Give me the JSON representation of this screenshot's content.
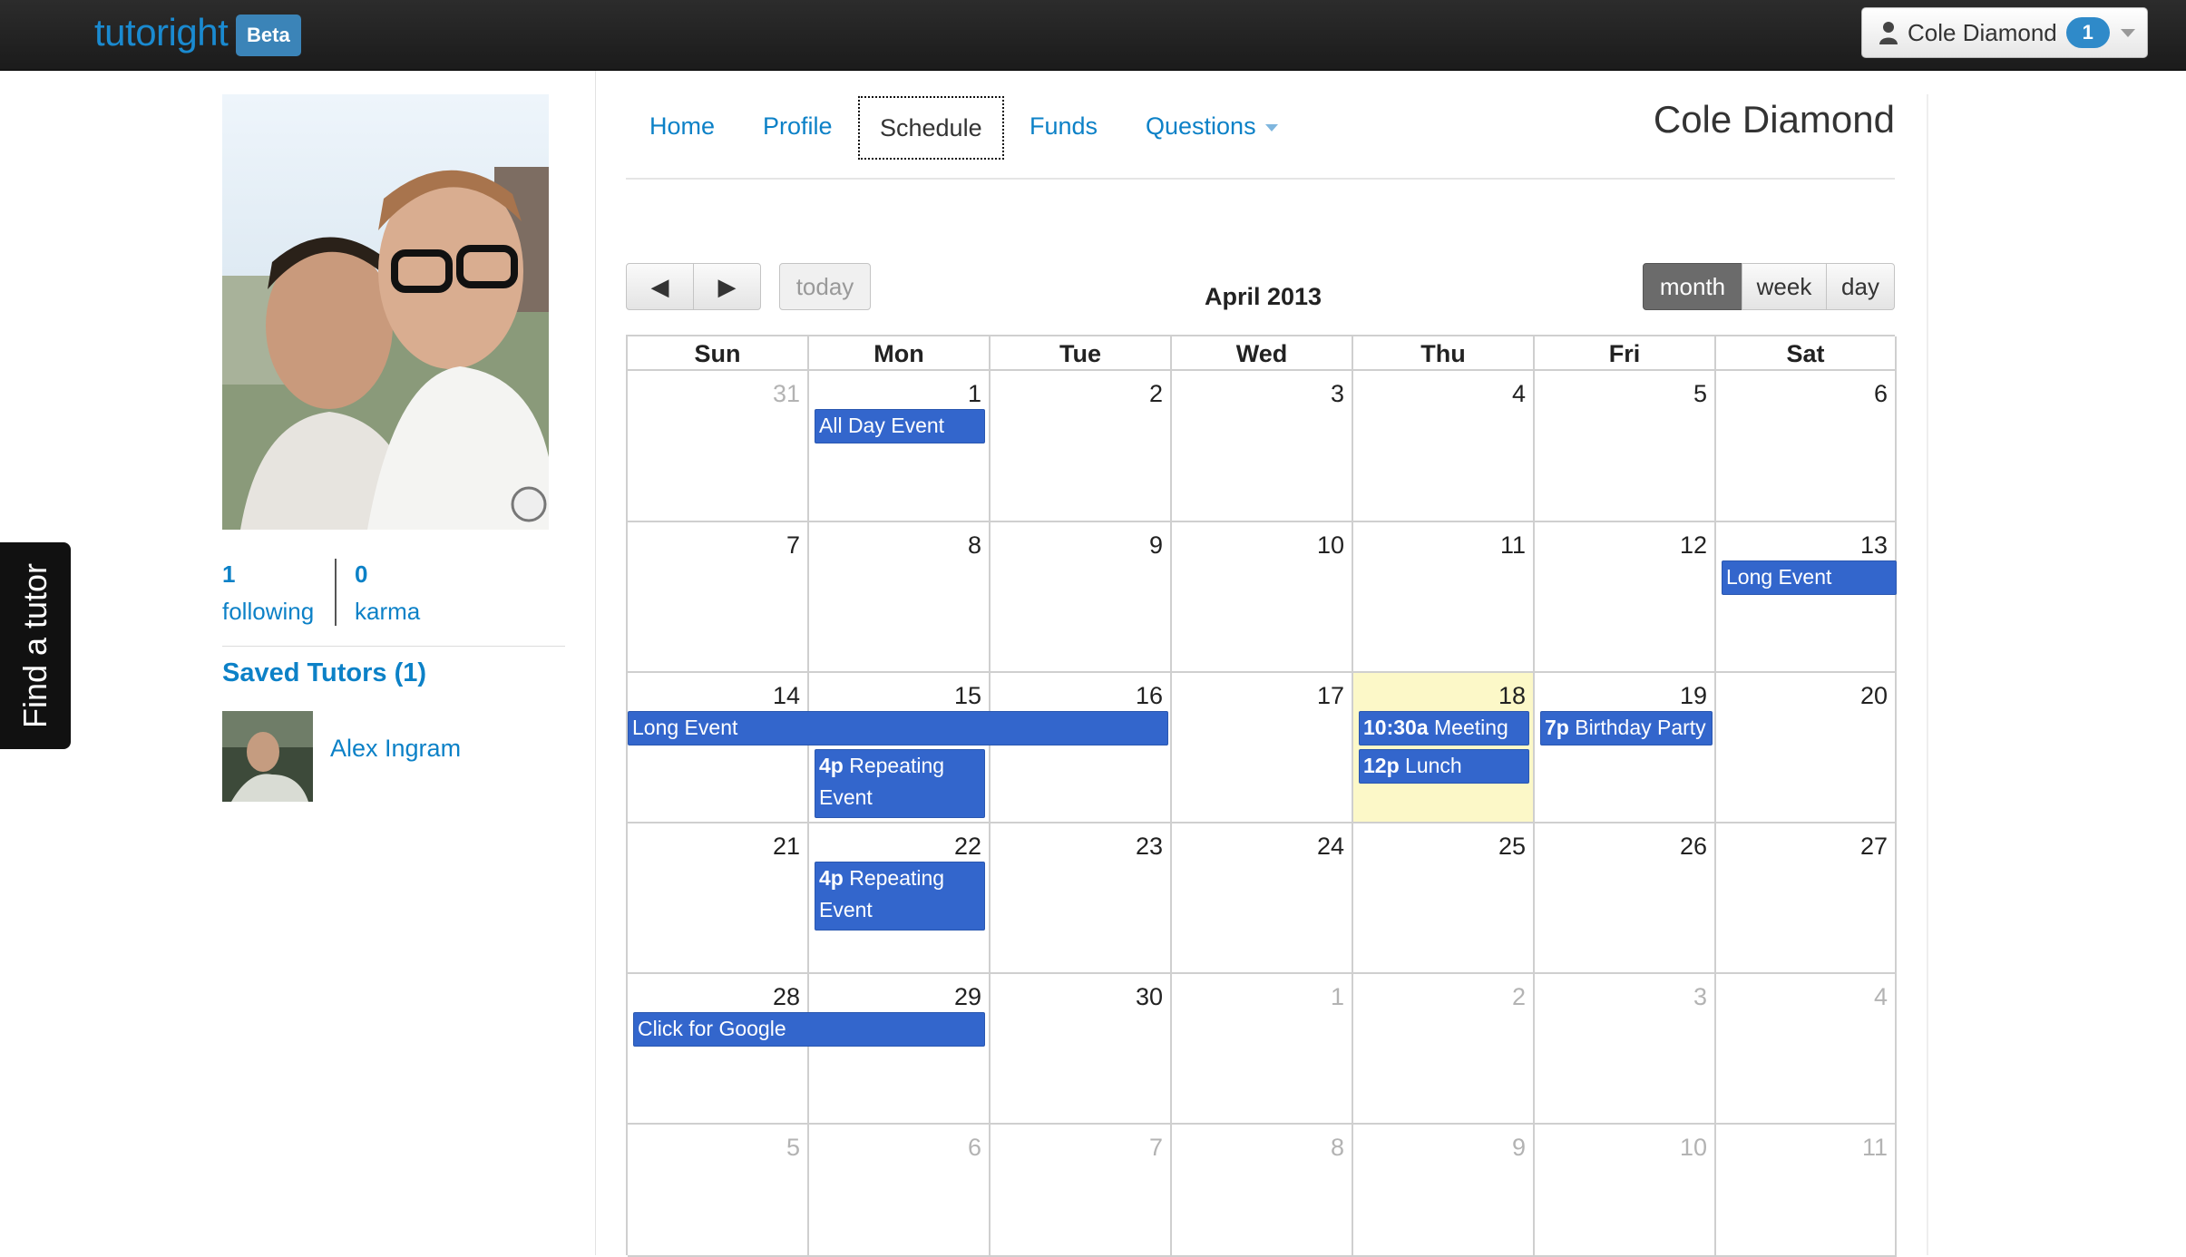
{
  "navbar": {
    "brand": "tutoright",
    "beta_badge": "Beta",
    "user_name": "Cole Diamond",
    "notification_count": "1"
  },
  "sidebar": {
    "following_count": "1",
    "following_label": "following",
    "karma_count": "0",
    "karma_label": "karma",
    "saved_tutors_title": "Saved Tutors (1)",
    "saved_tutors": [
      {
        "name": "Alex Ingram"
      }
    ],
    "find_tutor_tab": "Find a tutor"
  },
  "nav_tabs": [
    {
      "label": "Home"
    },
    {
      "label": "Profile"
    },
    {
      "label": "Schedule",
      "active": true
    },
    {
      "label": "Funds"
    },
    {
      "label": "Questions",
      "dropdown": true
    }
  ],
  "page_user_name": "Cole Diamond",
  "calendar": {
    "title": "April 2013",
    "prev_symbol": "◀",
    "next_symbol": "▶",
    "today_label": "today",
    "view_buttons": [
      "month",
      "week",
      "day"
    ],
    "active_view": "month",
    "weekdays": [
      "Sun",
      "Mon",
      "Tue",
      "Wed",
      "Thu",
      "Fri",
      "Sat"
    ],
    "today_date": "18",
    "weeks": [
      [
        "31",
        "1",
        "2",
        "3",
        "4",
        "5",
        "6"
      ],
      [
        "7",
        "8",
        "9",
        "10",
        "11",
        "12",
        "13"
      ],
      [
        "14",
        "15",
        "16",
        "17",
        "18",
        "19",
        "20"
      ],
      [
        "21",
        "22",
        "23",
        "24",
        "25",
        "26",
        "27"
      ],
      [
        "28",
        "29",
        "30",
        "1",
        "2",
        "3",
        "4"
      ],
      [
        "5",
        "6",
        "7",
        "8",
        "9",
        "10",
        "11"
      ]
    ],
    "events": [
      {
        "time": "",
        "title": "All Day Event"
      },
      {
        "time": "",
        "title": "Long Event"
      },
      {
        "time": "",
        "title": "Long Event"
      },
      {
        "time": "4p",
        "title": "Repeating Event"
      },
      {
        "time": "10:30a",
        "title": "Meeting"
      },
      {
        "time": "12p",
        "title": "Lunch"
      },
      {
        "time": "7p",
        "title": "Birthday Party"
      },
      {
        "time": "4p",
        "title": "Repeating Event"
      },
      {
        "time": "",
        "title": "Click for Google"
      }
    ]
  },
  "colors": {
    "brand_blue": "#1a8ad0",
    "link_blue": "#0c81c7",
    "event_blue": "#3366cc",
    "today_highlight": "#fcf8c8",
    "navbar_dark": "#1b1b1b"
  }
}
